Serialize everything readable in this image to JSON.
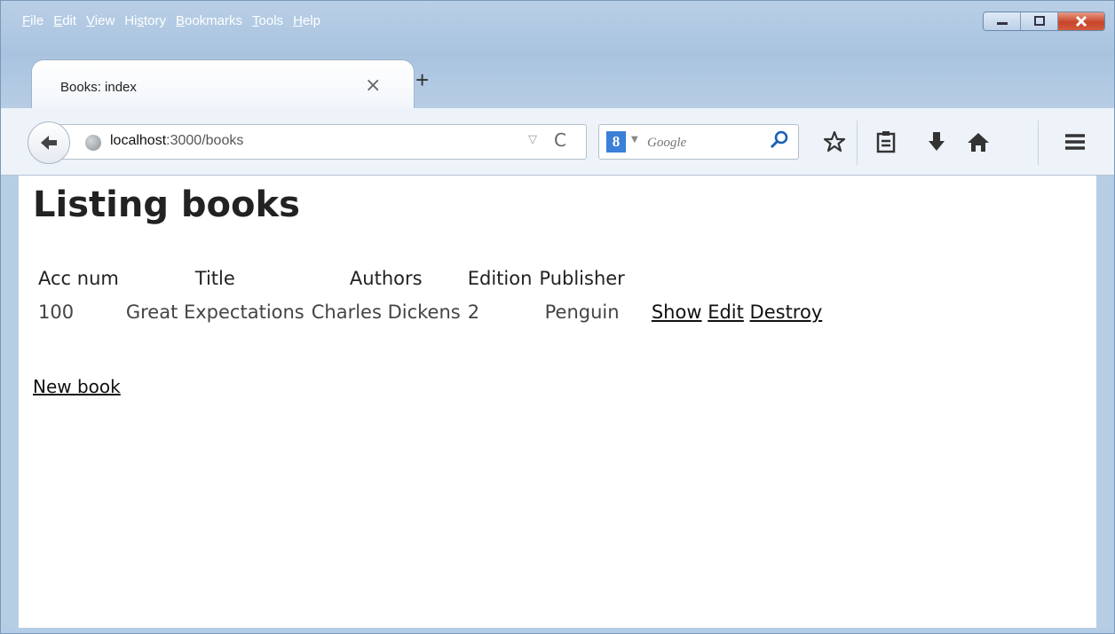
{
  "menubar": {
    "items": [
      {
        "pre": "",
        "acc": "F",
        "post": "ile"
      },
      {
        "pre": "",
        "acc": "E",
        "post": "dit"
      },
      {
        "pre": "",
        "acc": "V",
        "post": "iew"
      },
      {
        "pre": "Hi",
        "acc": "s",
        "post": "tory"
      },
      {
        "pre": "",
        "acc": "B",
        "post": "ookmarks"
      },
      {
        "pre": "",
        "acc": "T",
        "post": "ools"
      },
      {
        "pre": "",
        "acc": "H",
        "post": "elp"
      }
    ]
  },
  "tab": {
    "title": "Books: index",
    "close": "×"
  },
  "newtab": "+",
  "nav": {
    "url_host": "localhost",
    "url_rest": ":3000/books",
    "dropdown": "▽",
    "reload": "C"
  },
  "search": {
    "engine_letter": "8",
    "caret": "▼",
    "placeholder": "Google"
  },
  "page": {
    "heading": "Listing books",
    "table": {
      "headers": [
        "Acc num",
        "Title",
        "Authors",
        "Edition",
        "Publisher"
      ],
      "rows": [
        {
          "acc_num": "100",
          "title": "Great Expectations",
          "authors": "Charles Dickens",
          "edition": "2",
          "publisher": "Penguin",
          "show": "Show",
          "edit": "Edit",
          "destroy": "Destroy"
        }
      ]
    },
    "new_link": "New book"
  },
  "colors": {
    "chrome": "#a9c3df",
    "close_button": "#c7452b",
    "link": "#111111"
  },
  "icons": [
    "back-arrow-icon",
    "globe-icon",
    "reload-icon",
    "search-icon",
    "star-icon",
    "reading-list-icon",
    "download-icon",
    "home-icon",
    "hamburger-menu-icon"
  ]
}
